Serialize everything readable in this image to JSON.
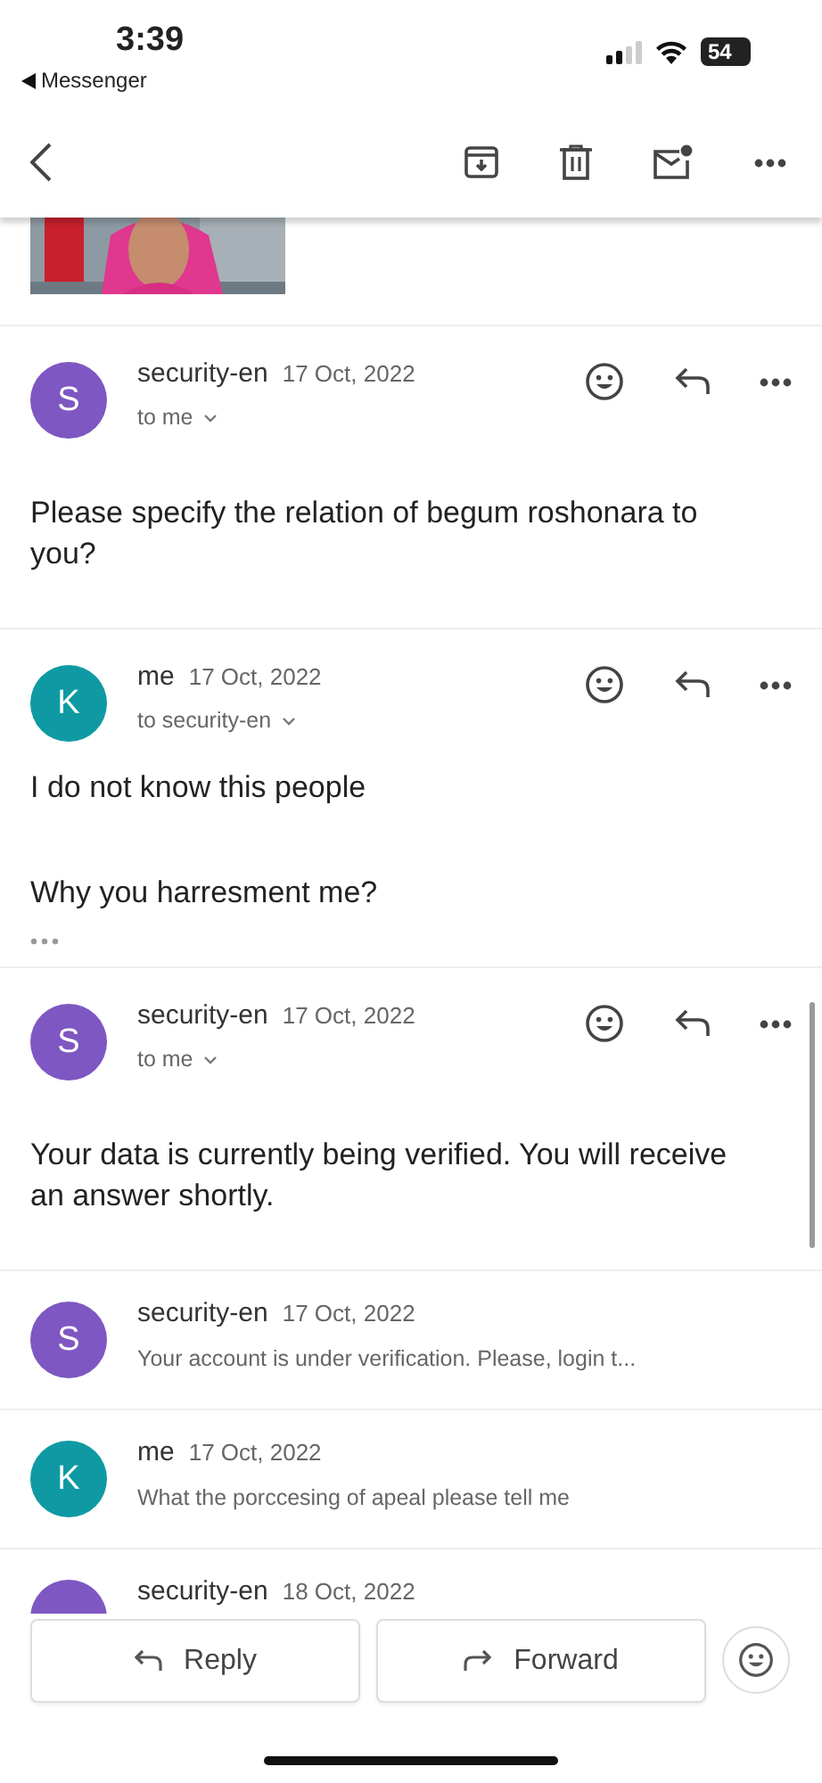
{
  "status_bar": {
    "time": "3:39",
    "back_app": "Messenger",
    "battery": "54"
  },
  "messages": [
    {
      "kind": "expanded",
      "avatar": "S",
      "color": "#7e57c2",
      "sender": "security-en",
      "date": "17 Oct, 2022",
      "recipient": "to me",
      "body": [
        "Please specify the relation of begum roshonara to you?"
      ]
    },
    {
      "kind": "expanded",
      "avatar": "K",
      "color": "#0f9aa3",
      "sender": "me",
      "date": "17 Oct, 2022",
      "recipient": "to security-en",
      "body": [
        "I do not know this people",
        "Why you harresment me?"
      ],
      "trimmed": true
    },
    {
      "kind": "expanded",
      "avatar": "S",
      "color": "#7e57c2",
      "sender": "security-en",
      "date": "17 Oct, 2022",
      "recipient": "to me",
      "body": [
        "Your data is currently being verified. You will receive an answer shortly."
      ]
    },
    {
      "kind": "collapsed",
      "avatar": "S",
      "color": "#7e57c2",
      "sender": "security-en",
      "date": "17 Oct, 2022",
      "snippet": "Your account is under verification. Please, login t..."
    },
    {
      "kind": "collapsed",
      "avatar": "K",
      "color": "#0f9aa3",
      "sender": "me",
      "date": "17 Oct, 2022",
      "snippet": "What the porccesing of apeal please tell me"
    },
    {
      "kind": "collapsed",
      "color": "#7e57c2",
      "sender": "security-en",
      "date": "18 Oct, 2022"
    }
  ],
  "actions": {
    "reply": "Reply",
    "forward": "Forward"
  }
}
